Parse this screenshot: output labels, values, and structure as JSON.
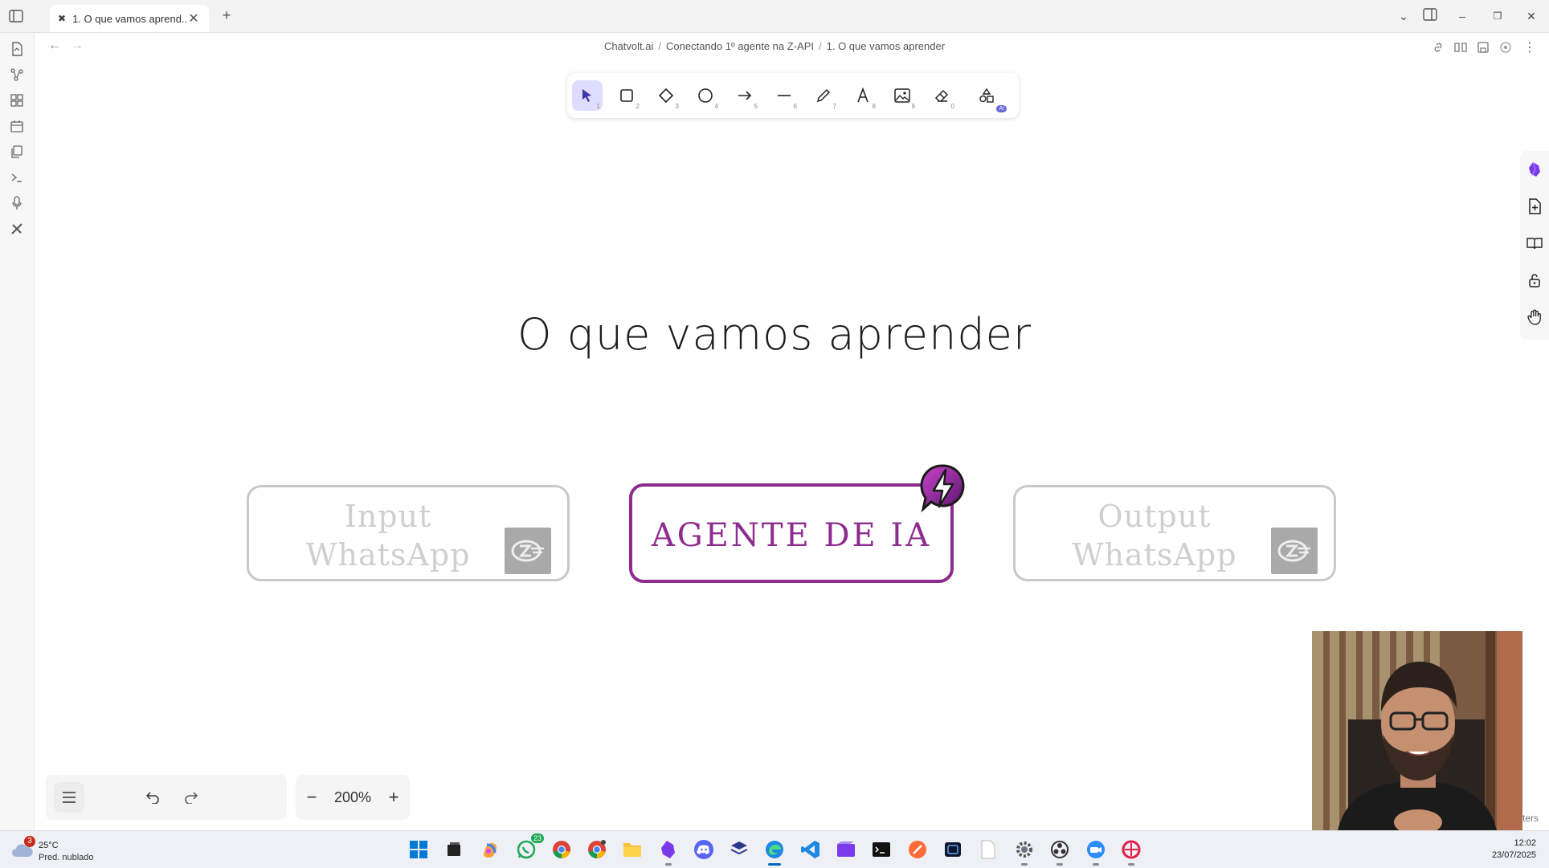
{
  "tab": {
    "title": "1. O que vamos aprend...",
    "close": "✕",
    "new_tab": "+"
  },
  "breadcrumb": {
    "part1": "Chatvolt.ai",
    "sep": "/",
    "part2": "Conectando 1º agente na Z-API",
    "part3": "1. O que vamos aprender"
  },
  "toolbar": {
    "tools": [
      {
        "name": "selection",
        "key": "1"
      },
      {
        "name": "rectangle",
        "key": "2"
      },
      {
        "name": "diamond",
        "key": "3"
      },
      {
        "name": "ellipse",
        "key": "4"
      },
      {
        "name": "arrow",
        "key": "5"
      },
      {
        "name": "line",
        "key": "6"
      },
      {
        "name": "draw",
        "key": "7"
      },
      {
        "name": "text",
        "key": "8"
      },
      {
        "name": "image",
        "key": "9"
      },
      {
        "name": "eraser",
        "key": "0"
      },
      {
        "name": "more-shapes",
        "badge": "AI"
      }
    ],
    "active_tool": "selection",
    "accent": "#6965db"
  },
  "canvas": {
    "title": "O que vamos aprender",
    "cards": {
      "input_line1": "Input",
      "input_line2": "WhatsApp",
      "agent": "AGENTE DE IA",
      "output_line1": "Output",
      "output_line2": "WhatsApp"
    },
    "agent_color": "#8e2b8e"
  },
  "zoom": {
    "level": "200%",
    "minus": "−",
    "plus": "+"
  },
  "webcam_fragment": "ters",
  "taskbar": {
    "weather": {
      "badge": "3",
      "temp": "25°C",
      "desc": "Pred. nublado"
    },
    "whatsapp_badge": "23",
    "time": "12:02",
    "date": "23/07/2025"
  }
}
